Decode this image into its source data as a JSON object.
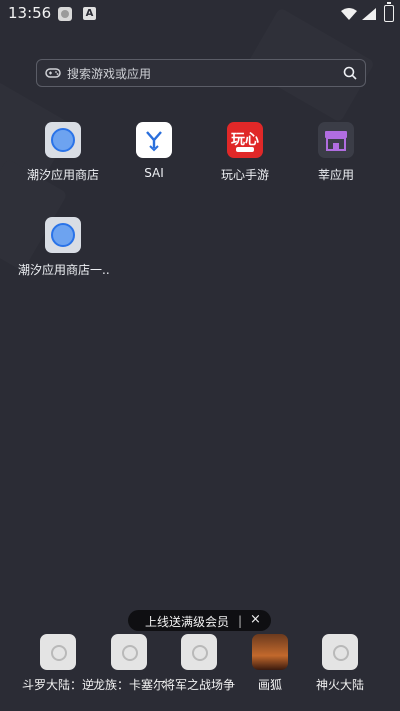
{
  "status_bar": {
    "time": "13:56",
    "battery_icon": "battery-charging-icon",
    "wifi_icon": "wifi-icon",
    "signal_icon": "signal-icon"
  },
  "search": {
    "placeholder": "搜索游戏或应用",
    "left_icon": "gamepad-icon",
    "right_icon": "search-icon"
  },
  "apps": [
    {
      "label": "潮汐应用商店",
      "icon": "app-store-icon"
    },
    {
      "label": "SAI",
      "icon": "sai-icon"
    },
    {
      "label": "玩心手游",
      "icon": "wanxin-icon"
    },
    {
      "label": "莘应用",
      "icon": "shen-app-icon"
    },
    {
      "label": "潮汐应用商店一..",
      "icon": "app-store-icon"
    }
  ],
  "page_indicator": {
    "pages": 2,
    "current": 2
  },
  "banner": {
    "text": "上线送满级会员",
    "close": "×"
  },
  "dock": [
    {
      "label": "斗罗大陆：逆",
      "icon": "placeholder-icon"
    },
    {
      "label": "龙族：卡塞尔",
      "icon": "placeholder-icon"
    },
    {
      "label": "将军之战场争",
      "icon": "placeholder-icon"
    },
    {
      "label": "画狐",
      "icon": "game-cover-icon"
    },
    {
      "label": "神火大陆",
      "icon": "placeholder-icon"
    }
  ],
  "colors": {
    "background": "#2b2c35",
    "text": "#eef0f4",
    "accent_blue": "#2a73e8",
    "red": "#e02828"
  }
}
